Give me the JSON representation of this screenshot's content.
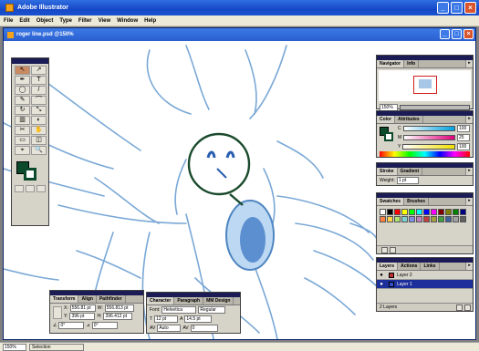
{
  "app": {
    "title": "Adobe Illustrator"
  },
  "menu": [
    "File",
    "Edit",
    "Object",
    "Type",
    "Filter",
    "View",
    "Window",
    "Help"
  ],
  "document": {
    "title": "roger line.psd @150%"
  },
  "navigator": {
    "tabs": [
      "Navigator",
      "Info"
    ],
    "zoom": "150%"
  },
  "color": {
    "tabs": [
      "Color",
      "Attributes"
    ],
    "channels": [
      {
        "label": "C",
        "value": "100"
      },
      {
        "label": "M",
        "value": "25"
      },
      {
        "label": "Y",
        "value": "100"
      },
      {
        "label": "K",
        "value": "50"
      }
    ]
  },
  "stroke": {
    "tabs": [
      "Stroke",
      "Gradient"
    ],
    "weight_label": "Weight:",
    "weight_value": "1 pt"
  },
  "swatches": {
    "tabs": [
      "Swatches",
      "Brushes"
    ],
    "colors": [
      "#ffffff",
      "#000000",
      "#ff0000",
      "#ffff00",
      "#00ff00",
      "#00ffff",
      "#0000ff",
      "#ff00ff",
      "#800000",
      "#808000",
      "#008000",
      "#000080",
      "#ff8040",
      "#ffd24a",
      "#b0e070",
      "#7fd0d0",
      "#8090e0",
      "#c080c0",
      "#c04040",
      "#a0a040",
      "#40a040",
      "#4060a0",
      "#a0a0a0",
      "#606060"
    ]
  },
  "layers": {
    "tabs": [
      "Layers",
      "Actions",
      "Links"
    ],
    "items": [
      {
        "name": "Layer 2",
        "color": "#c03030"
      },
      {
        "name": "Layer 1",
        "color": "#3050d0"
      }
    ],
    "count": "2 Layers"
  },
  "transform": {
    "tabs": [
      "Transform",
      "Align",
      "Pathfinder"
    ],
    "x": "556.81 pt",
    "y": "396 pt",
    "w": "556.813 pt",
    "h": "396.412 pt",
    "rotate": "0°",
    "shear": "0°"
  },
  "character": {
    "tabs": [
      "Character",
      "Paragraph",
      "MM Design"
    ],
    "font_label": "Font:",
    "font": "Helvetica",
    "style": "Regular",
    "size": "12 pt",
    "leading": "14.5 pt",
    "tracking": "Auto",
    "kerning": "0"
  },
  "status": {
    "zoom": "150%",
    "mode": "Selection"
  },
  "tools": [
    "↖",
    "↗",
    "✒",
    "T",
    "◯",
    "/",
    "✎",
    "⌒",
    "↻",
    "⤡",
    "▥",
    "◐",
    "✂",
    "✋",
    "▭",
    "◫",
    "⌖",
    "🔍"
  ]
}
